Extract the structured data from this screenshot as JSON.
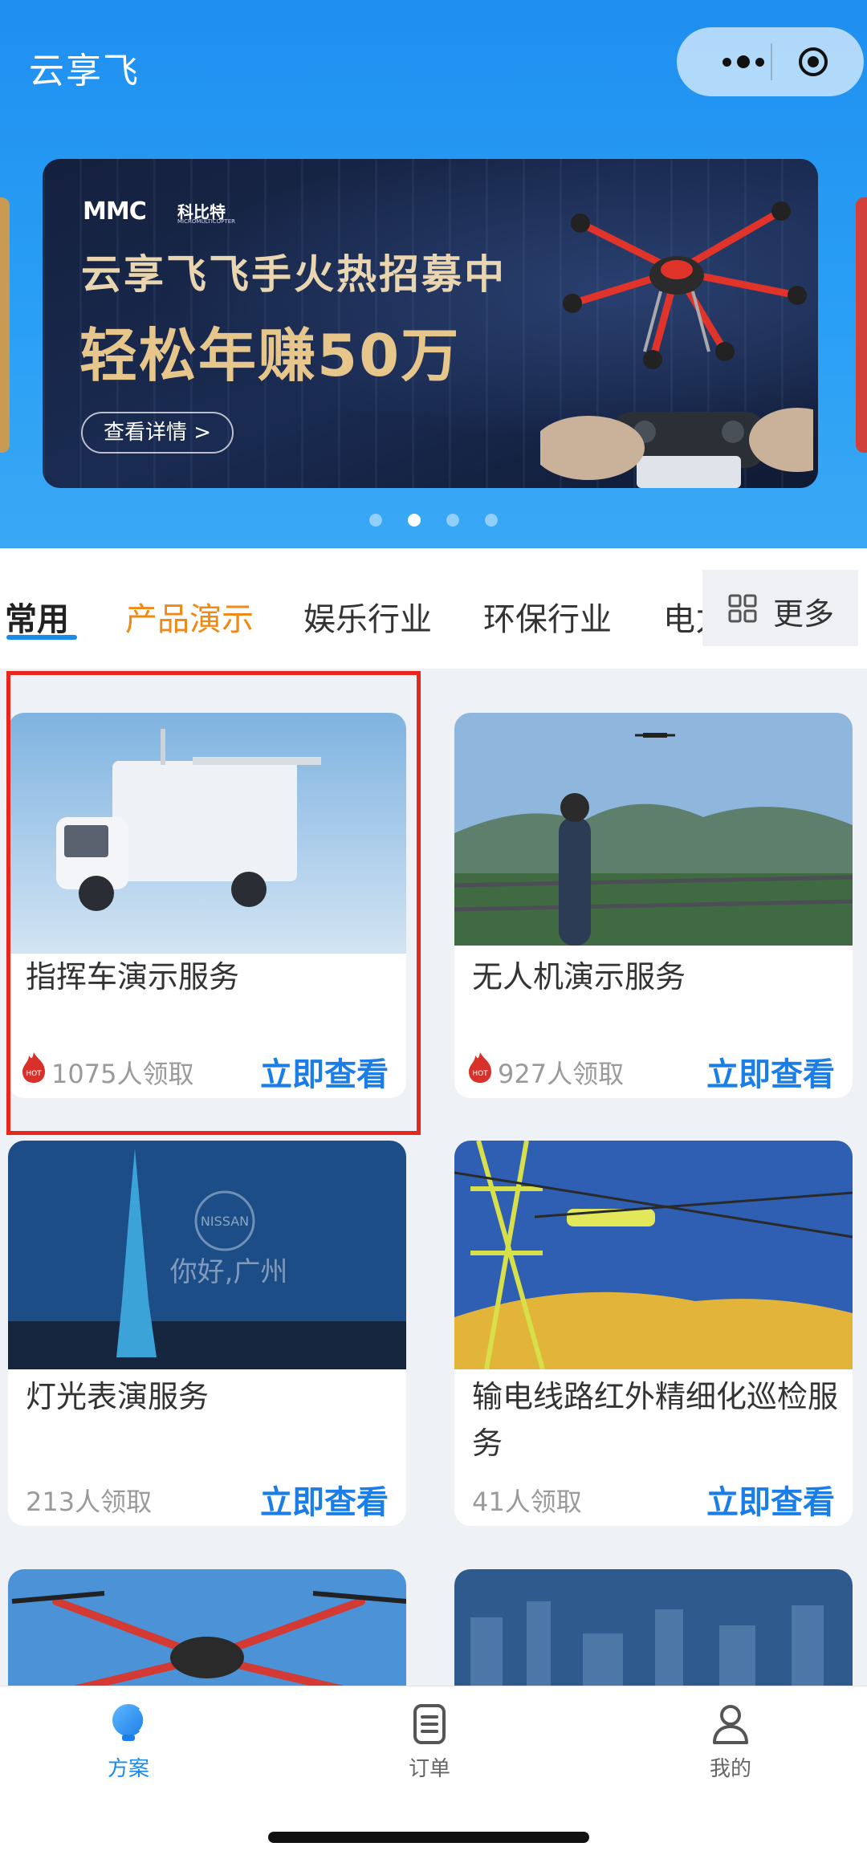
{
  "app": {
    "title": "云享飞"
  },
  "banner": {
    "brand_logo": "MMC",
    "brand_cn": "科比特",
    "brand_en": "MICROMULTICOPTER",
    "line1": "云享飞飞手火热招募中",
    "line2": "轻松年赚50万",
    "button_label": "查看详情 >",
    "carousel": {
      "count": 4,
      "active_index": 1
    }
  },
  "tabs": {
    "items": [
      "常用",
      "产品演示",
      "娱乐行业",
      "环保行业",
      "电力"
    ],
    "active_index": 0,
    "more_label": "更多"
  },
  "cards": [
    {
      "title": "指挥车演示服务",
      "count": "1075人领取",
      "hot": true,
      "action": "立即查看",
      "highlighted": true
    },
    {
      "title": "无人机演示服务",
      "count": "927人领取",
      "hot": true,
      "action": "立即查看"
    },
    {
      "title": "灯光表演服务",
      "count": "213人领取",
      "hot": false,
      "action": "立即查看",
      "overlay_text": "你好,广州",
      "overlay_logo": "NISSAN"
    },
    {
      "title": "输电线路红外精细化巡检服务",
      "count": "41人领取",
      "hot": false,
      "action": "立即查看"
    }
  ],
  "hot_badge": "HOT",
  "tabbar": {
    "items": [
      {
        "label": "方案",
        "icon": "bulb-icon",
        "active": true
      },
      {
        "label": "订单",
        "icon": "order-list-icon",
        "active": false
      },
      {
        "label": "我的",
        "icon": "user-icon",
        "active": false
      }
    ]
  },
  "colors": {
    "accent": "#1a8be8",
    "orange": "#f08a16",
    "highlight": "#e8261e",
    "header": "#2196f3"
  }
}
